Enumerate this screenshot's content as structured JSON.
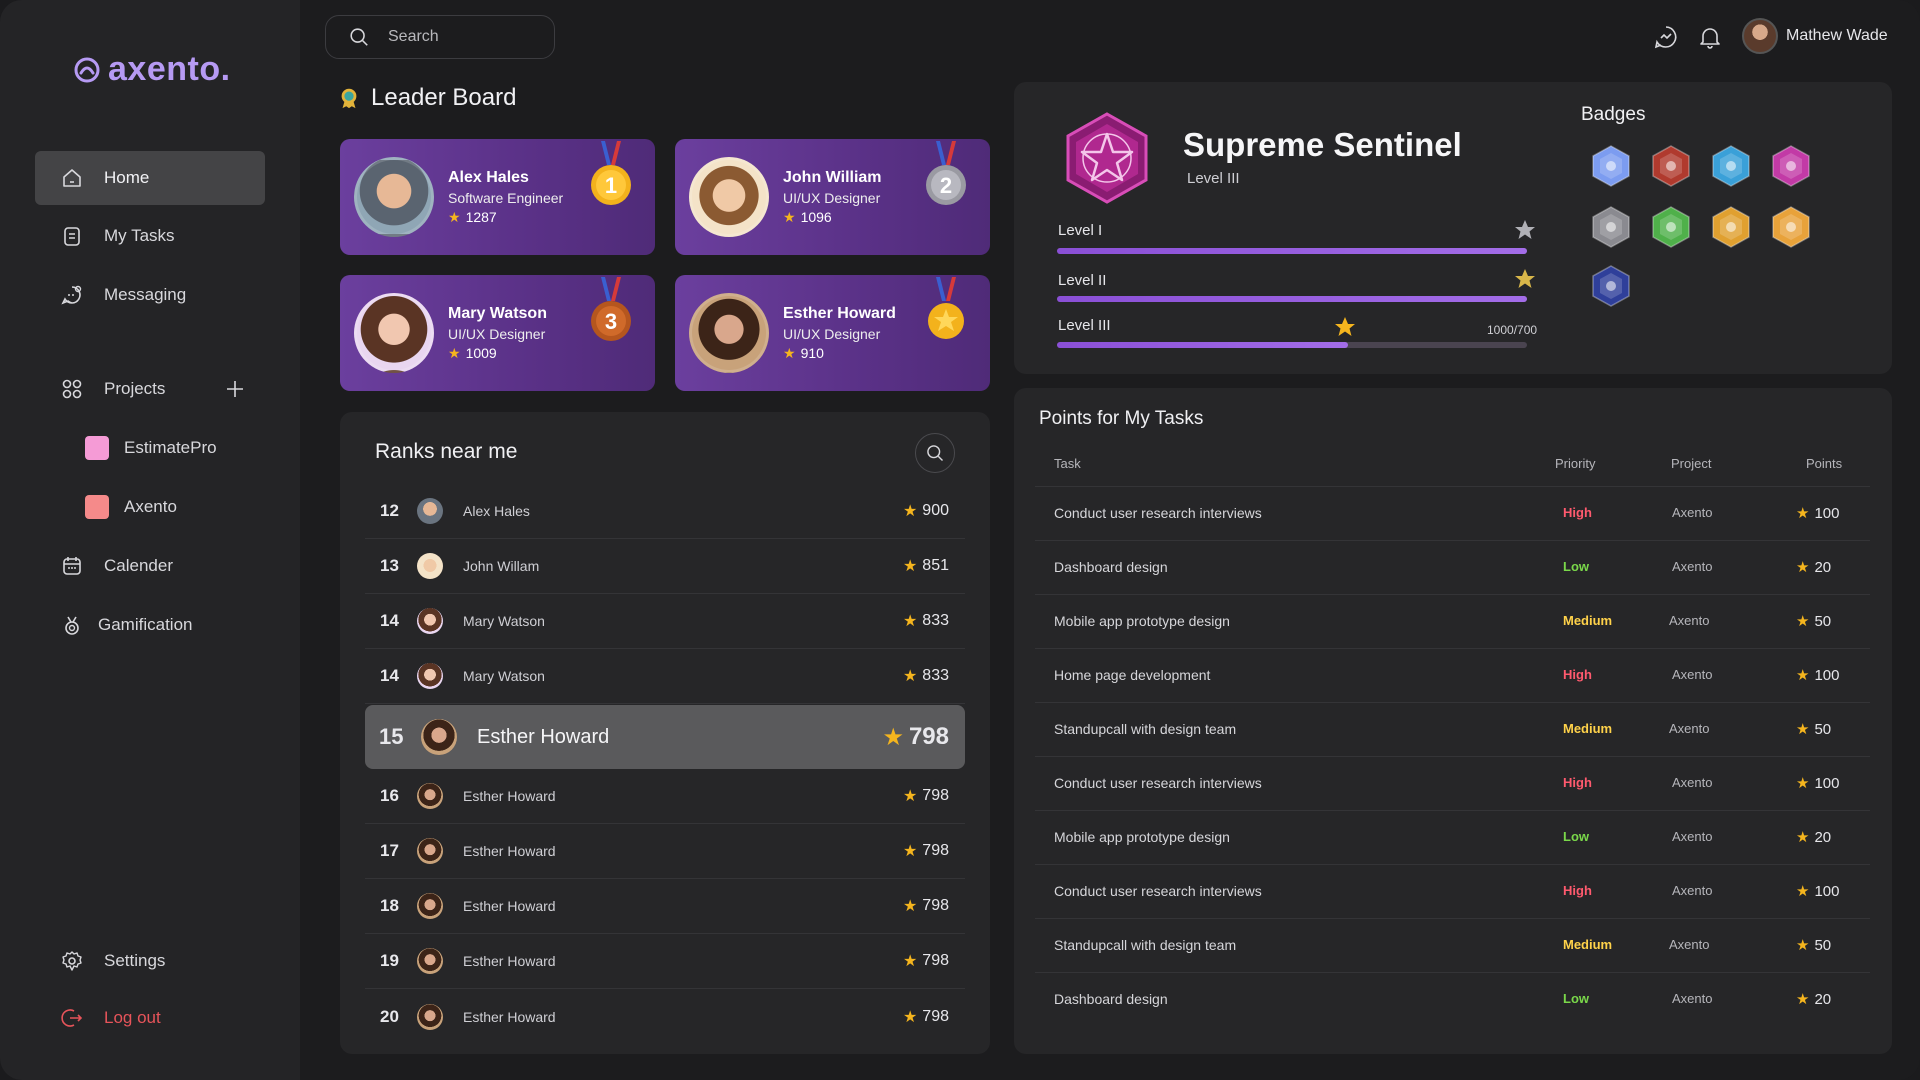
{
  "app": {
    "logo_text": "axento.",
    "accent": "#b69af3"
  },
  "sidebar": {
    "items": [
      {
        "label": "Home",
        "icon": "home-icon",
        "active": true
      },
      {
        "label": "My Tasks",
        "icon": "tasks-icon"
      },
      {
        "label": "Messaging",
        "icon": "messaging-icon"
      },
      {
        "label": "Projects",
        "icon": "projects-icon"
      },
      {
        "label": "EstimatePro",
        "color": "#f59bd6"
      },
      {
        "label": "Axento",
        "color": "#f58a8a"
      },
      {
        "label": "Calender",
        "icon": "calendar-icon"
      },
      {
        "label": "Gamification",
        "icon": "medal-icon"
      }
    ],
    "settings_label": "Settings",
    "logout_label": "Log out"
  },
  "topbar": {
    "search_placeholder": "Search",
    "user_name": "Mathew Wade"
  },
  "leaderboard": {
    "title": "Leader Board",
    "cards": [
      {
        "name": "Alex Hales",
        "role": "Software Engineer",
        "points": "1287",
        "rank": "1",
        "medal": "gold"
      },
      {
        "name": "John William",
        "role": "UI/UX Designer",
        "points": "1096",
        "rank": "2",
        "medal": "silver"
      },
      {
        "name": "Mary Watson",
        "role": "UI/UX Designer",
        "points": "1009",
        "rank": "3",
        "medal": "bronze"
      },
      {
        "name": "Esther Howard",
        "role": "UI/UX Designer",
        "points": "910",
        "rank": "",
        "medal": "star"
      }
    ]
  },
  "ranks": {
    "title": "Ranks near me",
    "rows": [
      {
        "rank": "12",
        "name": "Alex Hales",
        "points": "900"
      },
      {
        "rank": "13",
        "name": "John Willam",
        "points": "851"
      },
      {
        "rank": "14",
        "name": "Mary Watson",
        "points": "833"
      },
      {
        "rank": "14",
        "name": "Mary Watson",
        "points": "833"
      },
      {
        "rank": "15",
        "name": "Esther Howard",
        "points": "798",
        "me": true
      },
      {
        "rank": "16",
        "name": "Esther Howard",
        "points": "798"
      },
      {
        "rank": "17",
        "name": "Esther Howard",
        "points": "798"
      },
      {
        "rank": "18",
        "name": "Esther Howard",
        "points": "798"
      },
      {
        "rank": "19",
        "name": "Esther Howard",
        "points": "798"
      },
      {
        "rank": "20",
        "name": "Esther Howard",
        "points": "798"
      }
    ]
  },
  "achievement": {
    "title": "Supreme Sentinel",
    "level": "Level III",
    "levels": [
      {
        "label": "Level I",
        "progress": 1.0
      },
      {
        "label": "Level II",
        "progress": 1.0
      },
      {
        "label": "Level III",
        "progress": 0.62,
        "count": "1000/700"
      }
    ],
    "badges_title": "Badges",
    "badges": [
      {
        "name": "shield-badge-icon",
        "color": "#7c9cf0"
      },
      {
        "name": "flame-badge-icon",
        "color": "#b03a2e"
      },
      {
        "name": "titan-badge-icon",
        "color": "#3aa0d8"
      },
      {
        "name": "sentinel-badge-icon",
        "color": "#c23aa6"
      },
      {
        "name": "grey-badge-icon",
        "color": "#8a8a90"
      },
      {
        "name": "lotus-badge-icon",
        "color": "#4fb04a"
      },
      {
        "name": "gold-badge-icon",
        "color": "#e0a030"
      },
      {
        "name": "pyramid-badge-icon",
        "color": "#e8a23a"
      },
      {
        "name": "expert-badge-icon",
        "color": "#2f3f9a"
      }
    ]
  },
  "points_table": {
    "title": "Points for My Tasks",
    "headers": {
      "task": "Task",
      "priority": "Priority",
      "project": "Project",
      "points": "Points"
    },
    "rows": [
      {
        "task": "Conduct user research interviews",
        "priority": "High",
        "project": "Axento",
        "points": "100"
      },
      {
        "task": "Dashboard design",
        "priority": "Low",
        "project": "Axento",
        "points": "20"
      },
      {
        "task": "Mobile app prototype design",
        "priority": "Medium",
        "project": "Axento",
        "points": "50"
      },
      {
        "task": "Home page development",
        "priority": "High",
        "project": "Axento",
        "points": "100"
      },
      {
        "task": "Standupcall with design team",
        "priority": "Medium",
        "project": "Axento",
        "points": "50"
      },
      {
        "task": "Conduct user research interviews",
        "priority": "High",
        "project": "Axento",
        "points": "100"
      },
      {
        "task": "Mobile app prototype design",
        "priority": "Low",
        "project": "Axento",
        "points": "20"
      },
      {
        "task": "Conduct user research interviews",
        "priority": "High",
        "project": "Axento",
        "points": "100"
      },
      {
        "task": "Standupcall with design team",
        "priority": "Medium",
        "project": "Axento",
        "points": "50"
      },
      {
        "task": "Dashboard design",
        "priority": "Low",
        "project": "Axento",
        "points": "20"
      }
    ]
  }
}
